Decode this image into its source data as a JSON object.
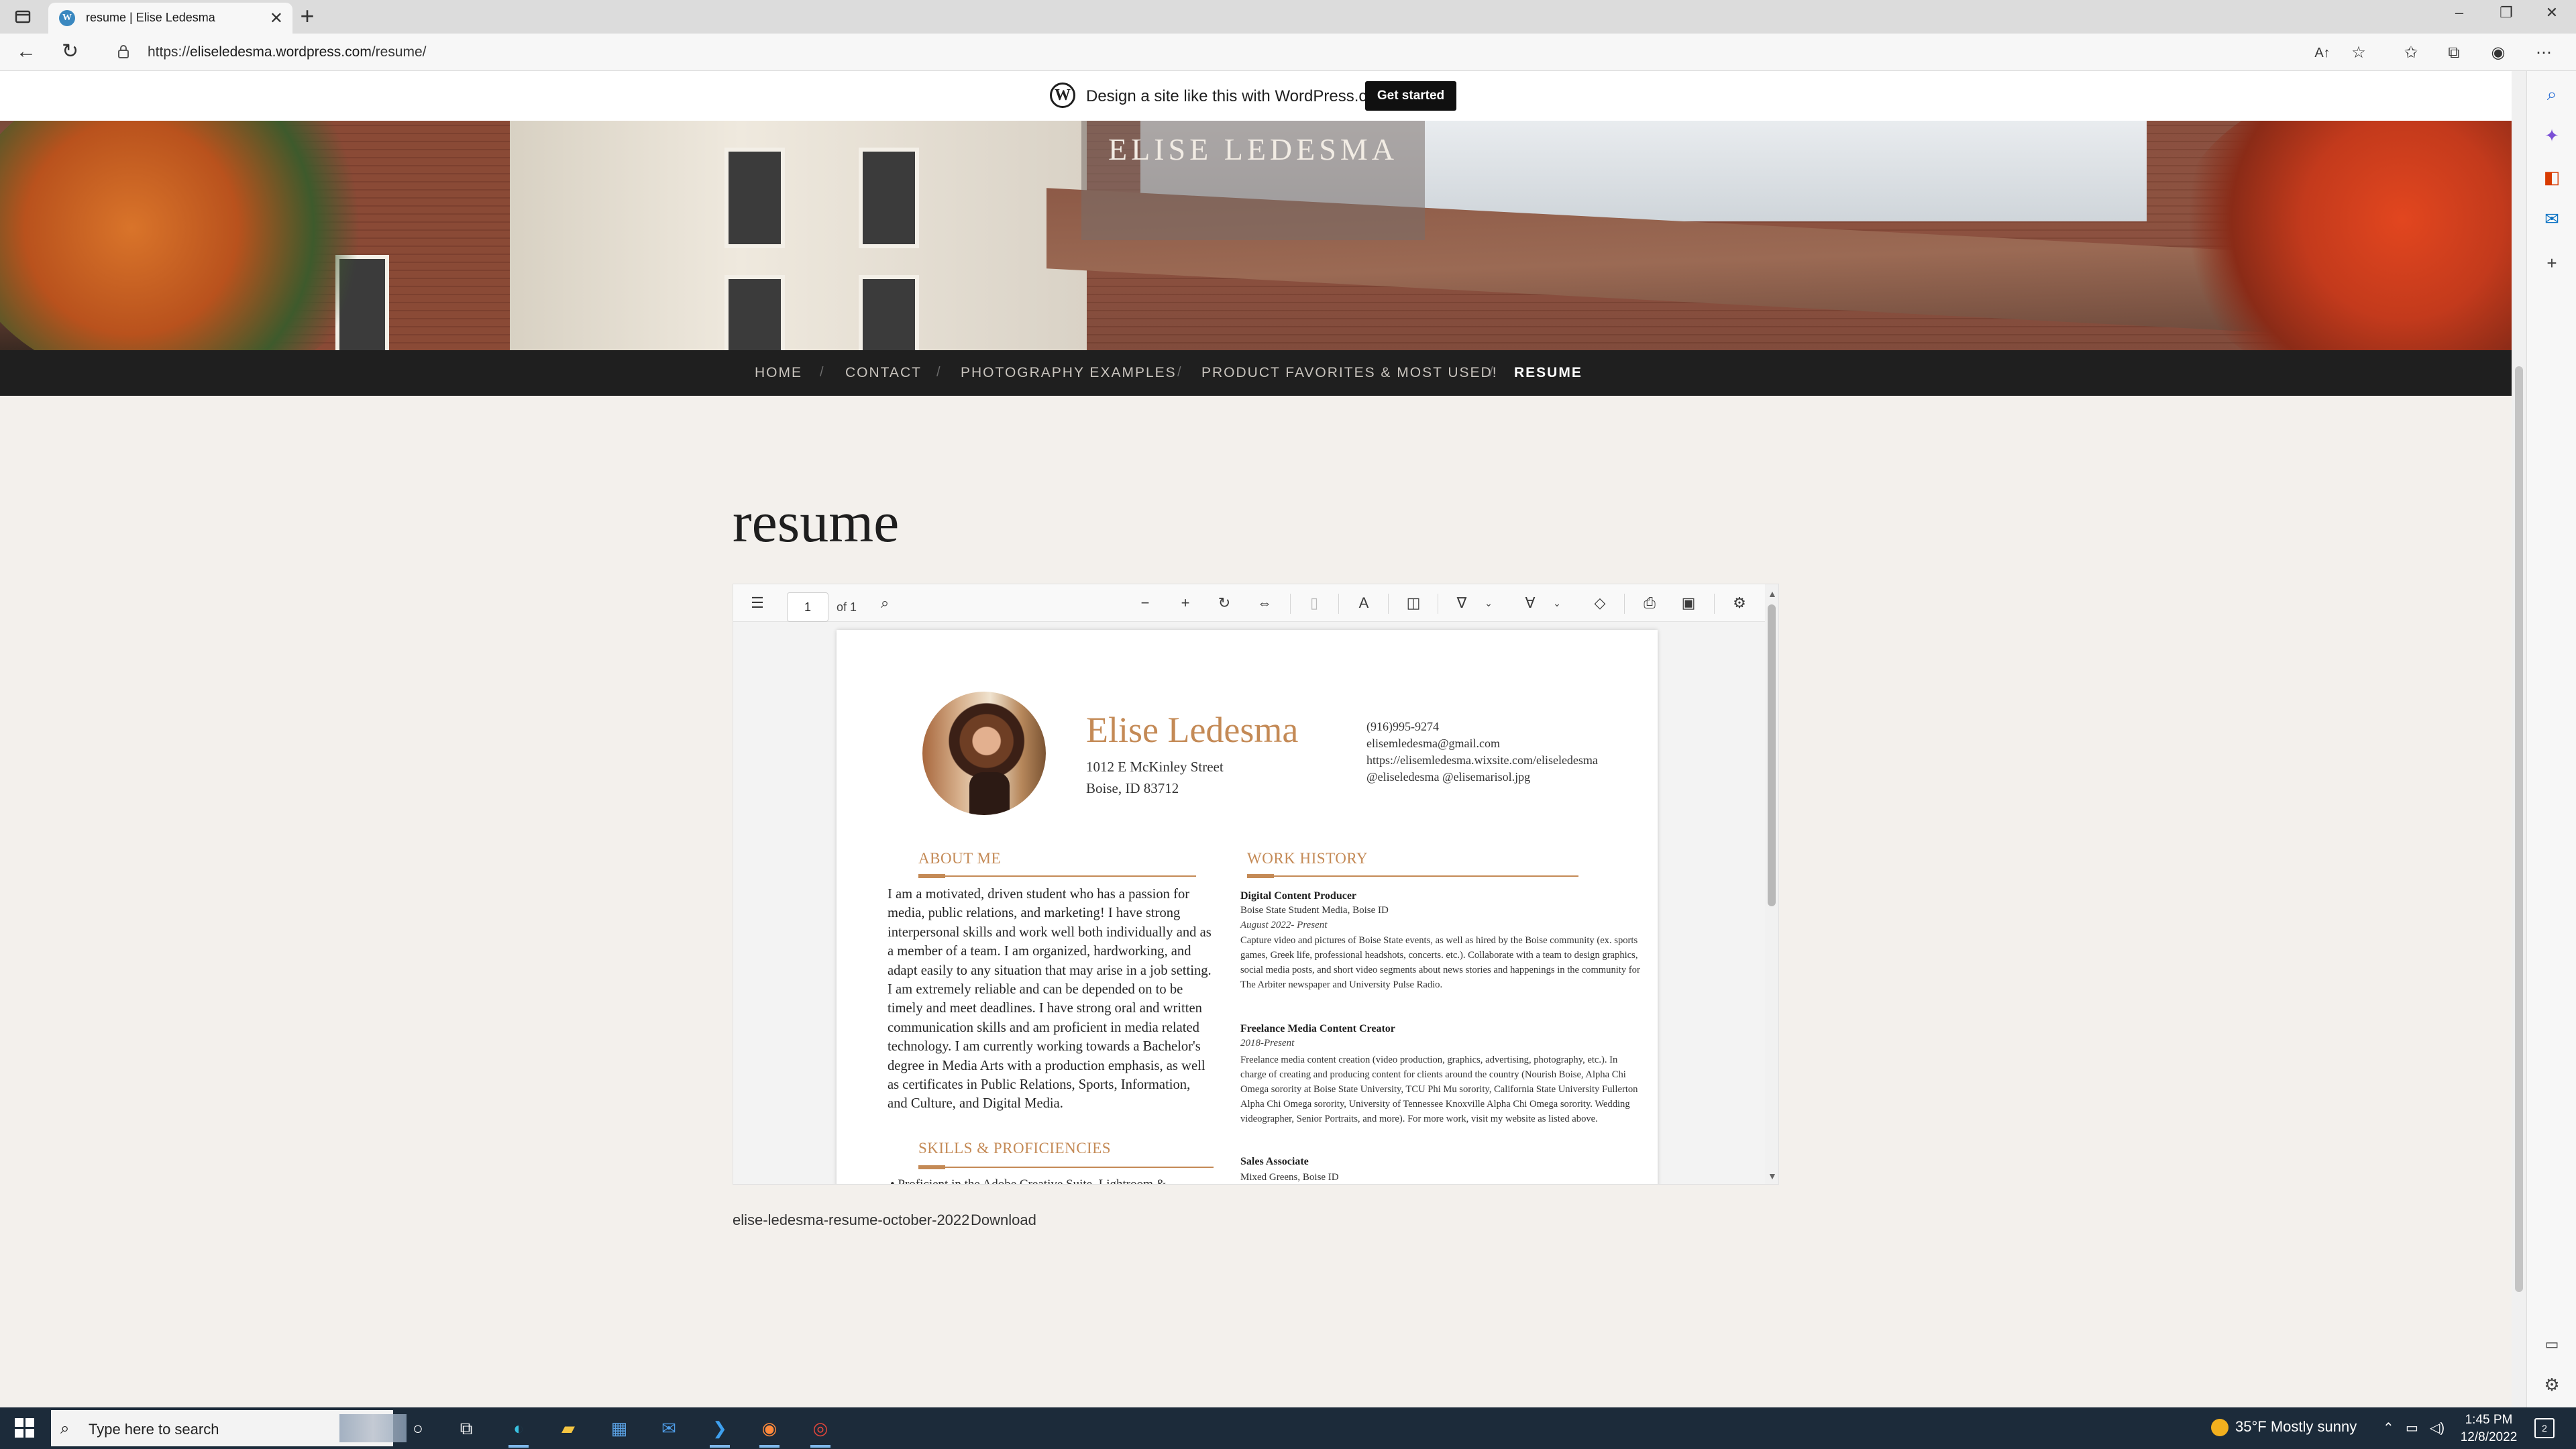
{
  "browser": {
    "tab_title": "resume | Elise Ledesma",
    "url_prefix": "https://",
    "url_host": "eliseledesma.wordpress.com",
    "url_path": "/resume/",
    "new_tab": "+",
    "close_tab": "✕"
  },
  "wp_bar": {
    "text": "Design a site like this with WordPress.com",
    "cta": "Get started"
  },
  "site": {
    "title": "ELISE LEDESMA",
    "nav": [
      "HOME",
      "CONTACT",
      "PHOTOGRAPHY EXAMPLES",
      "PRODUCT FAVORITES & MOST USED!",
      "RESUME"
    ],
    "nav_separator": "/",
    "active_nav": "RESUME"
  },
  "page": {
    "title": "resume",
    "file_name": "elise-ledesma-resume-october-2022",
    "download": "Download"
  },
  "pdf_viewer": {
    "page_number": "1",
    "page_of": "of 1"
  },
  "resume": {
    "name": "Elise Ledesma",
    "address_line1": "1012 E McKinley Street",
    "address_line2": "Boise, ID 83712",
    "phone": "(916)995-9274",
    "email": "elisemledesma@gmail.com",
    "website": "https://elisemledesma.wixsite.com/eliseledesma",
    "social": "@eliseledesma @elisemarisol.jpg",
    "about_heading": "ABOUT ME",
    "about_text": "I am a motivated, driven student who has a passion for media, public relations, and marketing! I have strong interpersonal skills and work well both individually and as a member of a team. I am organized, hardworking, and adapt easily to any situation that may arise in a job setting. I am extremely reliable and can be depended on to be timely and meet deadlines. I have strong oral and written communication skills and am proficient in media related technology. I am currently working towards a Bachelor's degree in Media Arts with a production emphasis, as well as certificates in Public Relations, Sports, Information, and Culture, and Digital Media.",
    "skills_heading": "SKILLS & PROFICIENCIES",
    "skills_first": "Proficient in the Adobe Creative Suite, Lightroom &",
    "work_heading": "WORK HISTORY",
    "jobs": [
      {
        "title": "Digital Content Producer",
        "org": "Boise State Student Media, Boise ID",
        "dates": "August 2022- Present",
        "desc": "Capture video and pictures of Boise State events, as well as hired by the Boise community (ex. sports games, Greek life, professional headshots, concerts. etc.). Collaborate with a team to design graphics, social media posts, and short video segments about news stories and happenings in the community for The Arbiter newspaper and University Pulse Radio."
      },
      {
        "title": "Freelance Media Content Creator",
        "org": "",
        "dates": "2018-Present",
        "desc": "Freelance media content creation (video production, graphics, advertising, photography, etc.). In charge of creating and producing content for clients around the country (Nourish Boise, Alpha Chi Omega sorority at Boise State University, TCU Phi Mu sorority, California State University Fullerton Alpha Chi Omega sorority, University of Tennessee Knoxville Alpha Chi Omega sorority. Wedding videographer, Senior Portraits, and more). For more work, visit my website as listed above."
      },
      {
        "title": "Sales Associate",
        "org": "Mixed Greens, Boise ID",
        "dates": "",
        "desc": ""
      }
    ]
  },
  "taskbar": {
    "search_placeholder": "Type here to search",
    "weather": "35°F  Mostly sunny",
    "time": "1:45 PM",
    "date": "12/8/2022",
    "notifications": "2"
  },
  "icons": {
    "wordpress": "W",
    "search": "⌕",
    "reload": "↻",
    "back": "←"
  }
}
